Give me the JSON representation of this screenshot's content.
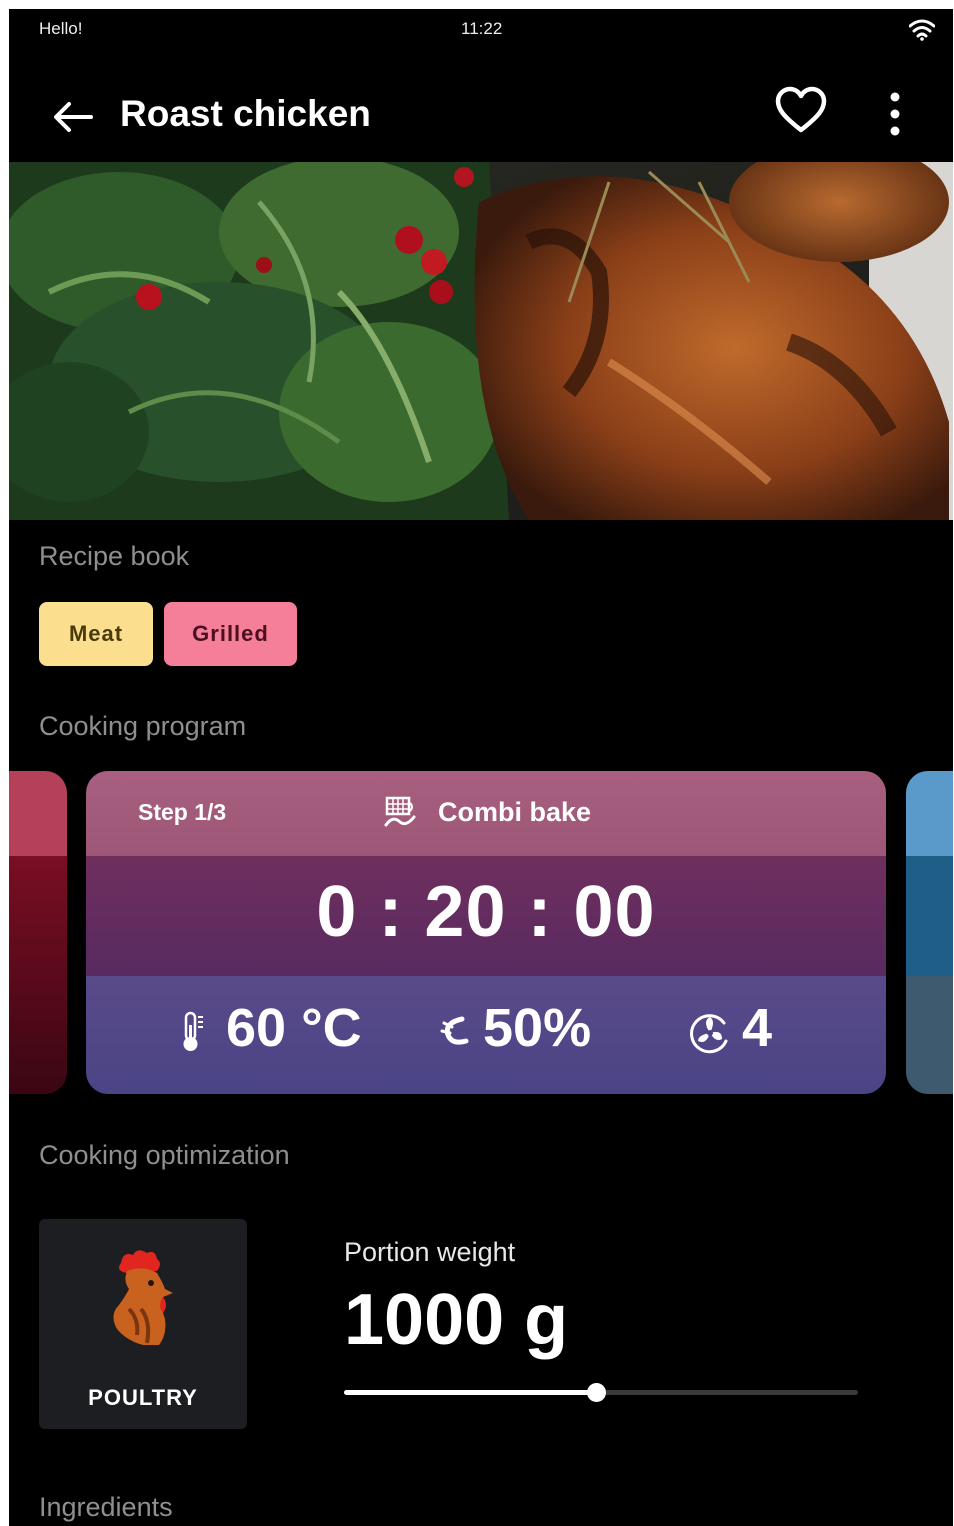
{
  "status_bar": {
    "greeting": "Hello!",
    "time": "11:22",
    "wifi_icon": "wifi-icon"
  },
  "app_bar": {
    "back_icon": "arrow-left-icon",
    "title": "Roast chicken",
    "favorite_icon": "heart-outline-icon",
    "menu_icon": "more-vertical-icon"
  },
  "hero_image": {
    "icon": "roast-chicken-photo"
  },
  "recipe_book": {
    "title": "Recipe book",
    "tags": [
      {
        "label": "Meat",
        "color": "#fcdf8e"
      },
      {
        "label": "Grilled",
        "color": "#f57f98"
      }
    ]
  },
  "cooking_program": {
    "title": "Cooking program",
    "current_step": {
      "step": "Step 1/3",
      "mode": "Combi bake",
      "mode_icon": "combi-bake-icon",
      "time": "0 : 20 : 00",
      "temperature": "60 °C",
      "temperature_icon": "thermometer-icon",
      "humidity": "50%",
      "humidity_icon": "steam-icon",
      "fan": "4",
      "fan_icon": "fan-icon"
    }
  },
  "cooking_optimization": {
    "title": "Cooking optimization",
    "food_type": {
      "label": "POULTRY",
      "icon": "rooster-icon"
    },
    "portion": {
      "label": "Portion weight",
      "value": "1000 g",
      "slider_fraction": 0.49
    }
  },
  "ingredients": {
    "title": "Ingredients"
  },
  "colors": {
    "background": "#000000",
    "meat_chip": "#fcdf8e",
    "grilled_chip": "#f57f98",
    "card_top": "#a85f80",
    "card_middle": "#6f2f5d",
    "card_bottom": "#4a4485"
  }
}
